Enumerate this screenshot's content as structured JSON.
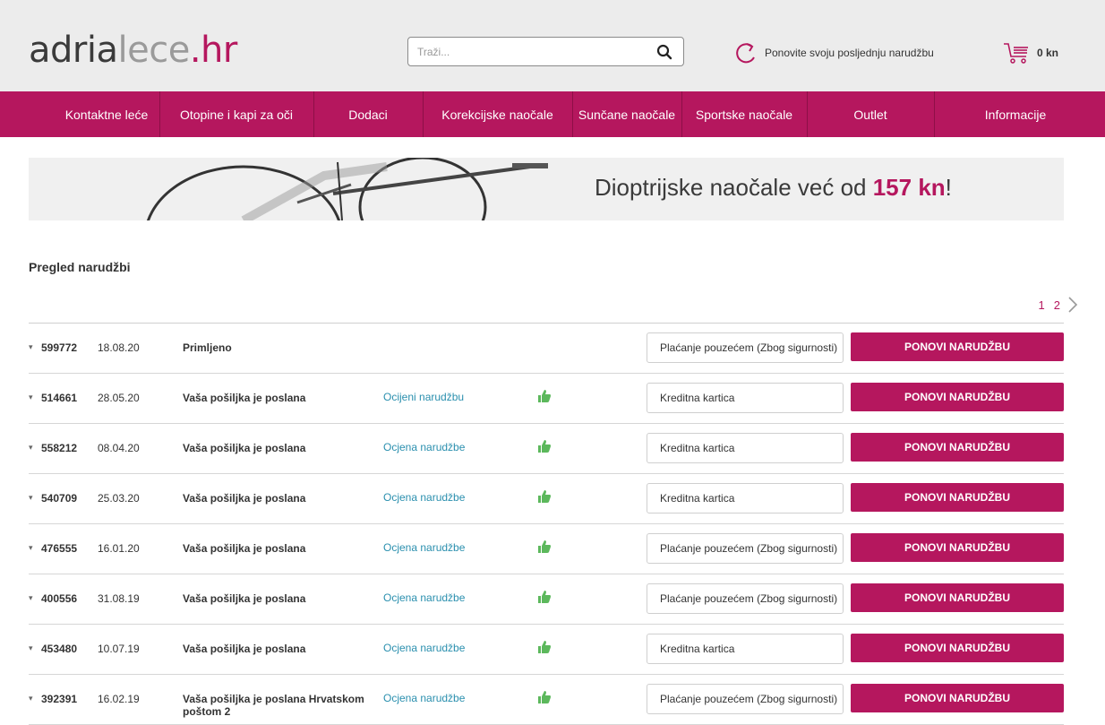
{
  "header": {
    "logo": {
      "part1": "adria",
      "part2": "lece",
      "part3": ".hr"
    },
    "search": {
      "placeholder": "Traži...",
      "value": ""
    },
    "reorder_label": "Ponovite svoju posljednju narudžbu",
    "cart_total": "0 kn"
  },
  "nav": {
    "items": [
      {
        "label": "Kontaktne leće"
      },
      {
        "label": "Otopine i kapi za oči"
      },
      {
        "label": "Dodaci"
      },
      {
        "label": "Korekcijske naočale"
      },
      {
        "label": "Sunčane naočale"
      },
      {
        "label": "Sportske naočale"
      },
      {
        "label": "Outlet"
      },
      {
        "label": "Informacije"
      }
    ]
  },
  "banner": {
    "text_before": "Dioptrijske naočale već od ",
    "text_highlight": "157 kn",
    "text_after": "!"
  },
  "page": {
    "title": "Pregled narudžbi"
  },
  "pagination": {
    "pages": [
      "1",
      "2"
    ],
    "current": "1"
  },
  "orders": [
    {
      "id": "599772",
      "date": "18.08.20",
      "status": "Primljeno",
      "rating": "",
      "thumb": false,
      "payment": "Plaćanje pouzećem (Zbog sigurnosti)",
      "button": "PONOVI NARUDŽBU"
    },
    {
      "id": "514661",
      "date": "28.05.20",
      "status": "Vaša pošiljka je poslana",
      "rating": "Ocijeni narudžbu",
      "thumb": true,
      "payment": "Kreditna kartica",
      "button": "PONOVI NARUDŽBU"
    },
    {
      "id": "558212",
      "date": "08.04.20",
      "status": "Vaša pošiljka je poslana",
      "rating": "Ocjena narudžbe",
      "thumb": true,
      "payment": "Kreditna kartica",
      "button": "PONOVI NARUDŽBU"
    },
    {
      "id": "540709",
      "date": "25.03.20",
      "status": "Vaša pošiljka je poslana",
      "rating": "Ocjena narudžbe",
      "thumb": true,
      "payment": "Kreditna kartica",
      "button": "PONOVI NARUDŽBU"
    },
    {
      "id": "476555",
      "date": "16.01.20",
      "status": "Vaša pošiljka je poslana",
      "rating": "Ocjena narudžbe",
      "thumb": true,
      "payment": "Plaćanje pouzećem (Zbog sigurnosti)",
      "button": "PONOVI NARUDŽBU"
    },
    {
      "id": "400556",
      "date": "31.08.19",
      "status": "Vaša pošiljka je poslana",
      "rating": "Ocjena narudžbe",
      "thumb": true,
      "payment": "Plaćanje pouzećem (Zbog sigurnosti)",
      "button": "PONOVI NARUDŽBU"
    },
    {
      "id": "453480",
      "date": "10.07.19",
      "status": "Vaša pošiljka je poslana",
      "rating": "Ocjena narudžbe",
      "thumb": true,
      "payment": "Kreditna kartica",
      "button": "PONOVI NARUDŽBU"
    },
    {
      "id": "392391",
      "date": "16.02.19",
      "status": "Vaša pošiljka je poslana Hrvatskom poštom 2",
      "rating": "Ocjena narudžbe",
      "thumb": true,
      "payment": "Plaćanje pouzećem (Zbog sigurnosti)",
      "button": "PONOVI NARUDŽBU"
    }
  ],
  "colors": {
    "brand": "#b5175e",
    "link": "#2a8fae",
    "thumb": "#5cb85c",
    "header_bg": "#ececec"
  },
  "icons": {
    "search": "search-icon",
    "reorder": "refresh-icon",
    "cart": "cart-icon",
    "rating": "thumbs-up-icon",
    "next": "chevron-right-icon",
    "toggle": "caret-down-icon"
  }
}
